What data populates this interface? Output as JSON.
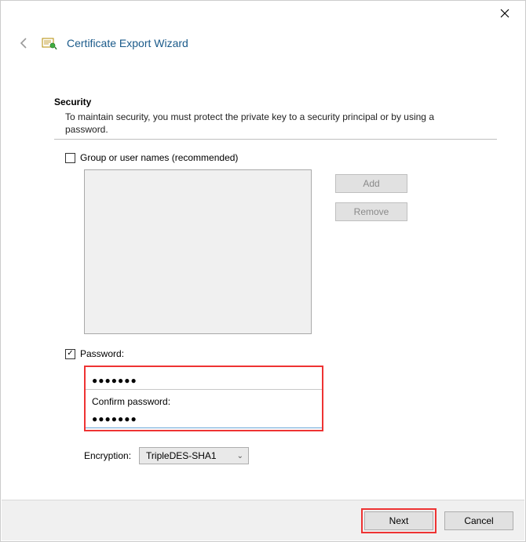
{
  "window": {
    "title": "Certificate Export Wizard"
  },
  "section": {
    "title": "Security",
    "description": "To maintain security, you must protect the private key to a security principal or by using a password."
  },
  "group_checkbox": {
    "label": "Group or user names (recommended)",
    "checked": false
  },
  "buttons": {
    "add": "Add",
    "remove": "Remove",
    "next": "Next",
    "cancel": "Cancel"
  },
  "password_checkbox": {
    "label": "Password:",
    "checked": true
  },
  "password": {
    "value": "●●●●●●●",
    "confirm_label": "Confirm password:",
    "confirm_value": "●●●●●●●"
  },
  "encryption": {
    "label": "Encryption:",
    "value": "TripleDES-SHA1"
  }
}
